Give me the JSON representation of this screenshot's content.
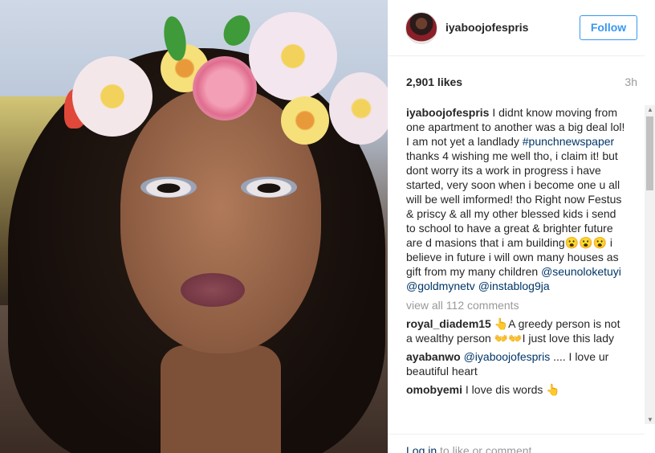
{
  "post": {
    "username": "iyaboojofespris",
    "follow_label": "Follow",
    "likes": "2,901 likes",
    "time": "3h",
    "caption_parts": {
      "a": "I didnt know moving from one apartment to another was a big deal lol! I am not yet a landlady ",
      "hashtag": "#punchnewspaper",
      "b": " thanks 4 wishing me well tho, i claim it! but dont worry its a work in progress i have started, very soon when i become one u all will be well imformed! tho Right now Festus & priscy & all my other blessed kids i send to school to have a great & brighter future are d masions that i am building😮😮😮 i believe in future i will own many houses as gift from my many children ",
      "mention1": "@seunoloketuyi",
      "mention2": "@goldmynetv",
      "mention3": "@instablog9ja"
    },
    "view_all": "view all 112 comments",
    "comments": [
      {
        "user": "royal_diadem15",
        "text": " 👆A greedy person is not a wealthy person 👐👐I just love this lady"
      },
      {
        "user": "ayabanwo",
        "mention": "@iyaboojofespris",
        "text": " .... I love ur beautiful heart"
      },
      {
        "user": "omobyemi",
        "text": " I love dis words 👆"
      }
    ],
    "footer": {
      "login_link": "Log in",
      "login_rest": " to like or comment.",
      "more": "..."
    }
  },
  "icons": {
    "avatar": "profile-avatar",
    "more": "more-options-icon",
    "scroll_up": "scroll-up-icon",
    "scroll_down": "scroll-down-icon"
  },
  "colors": {
    "accent": "#3897f0",
    "link": "#003569",
    "muted": "#999999"
  }
}
